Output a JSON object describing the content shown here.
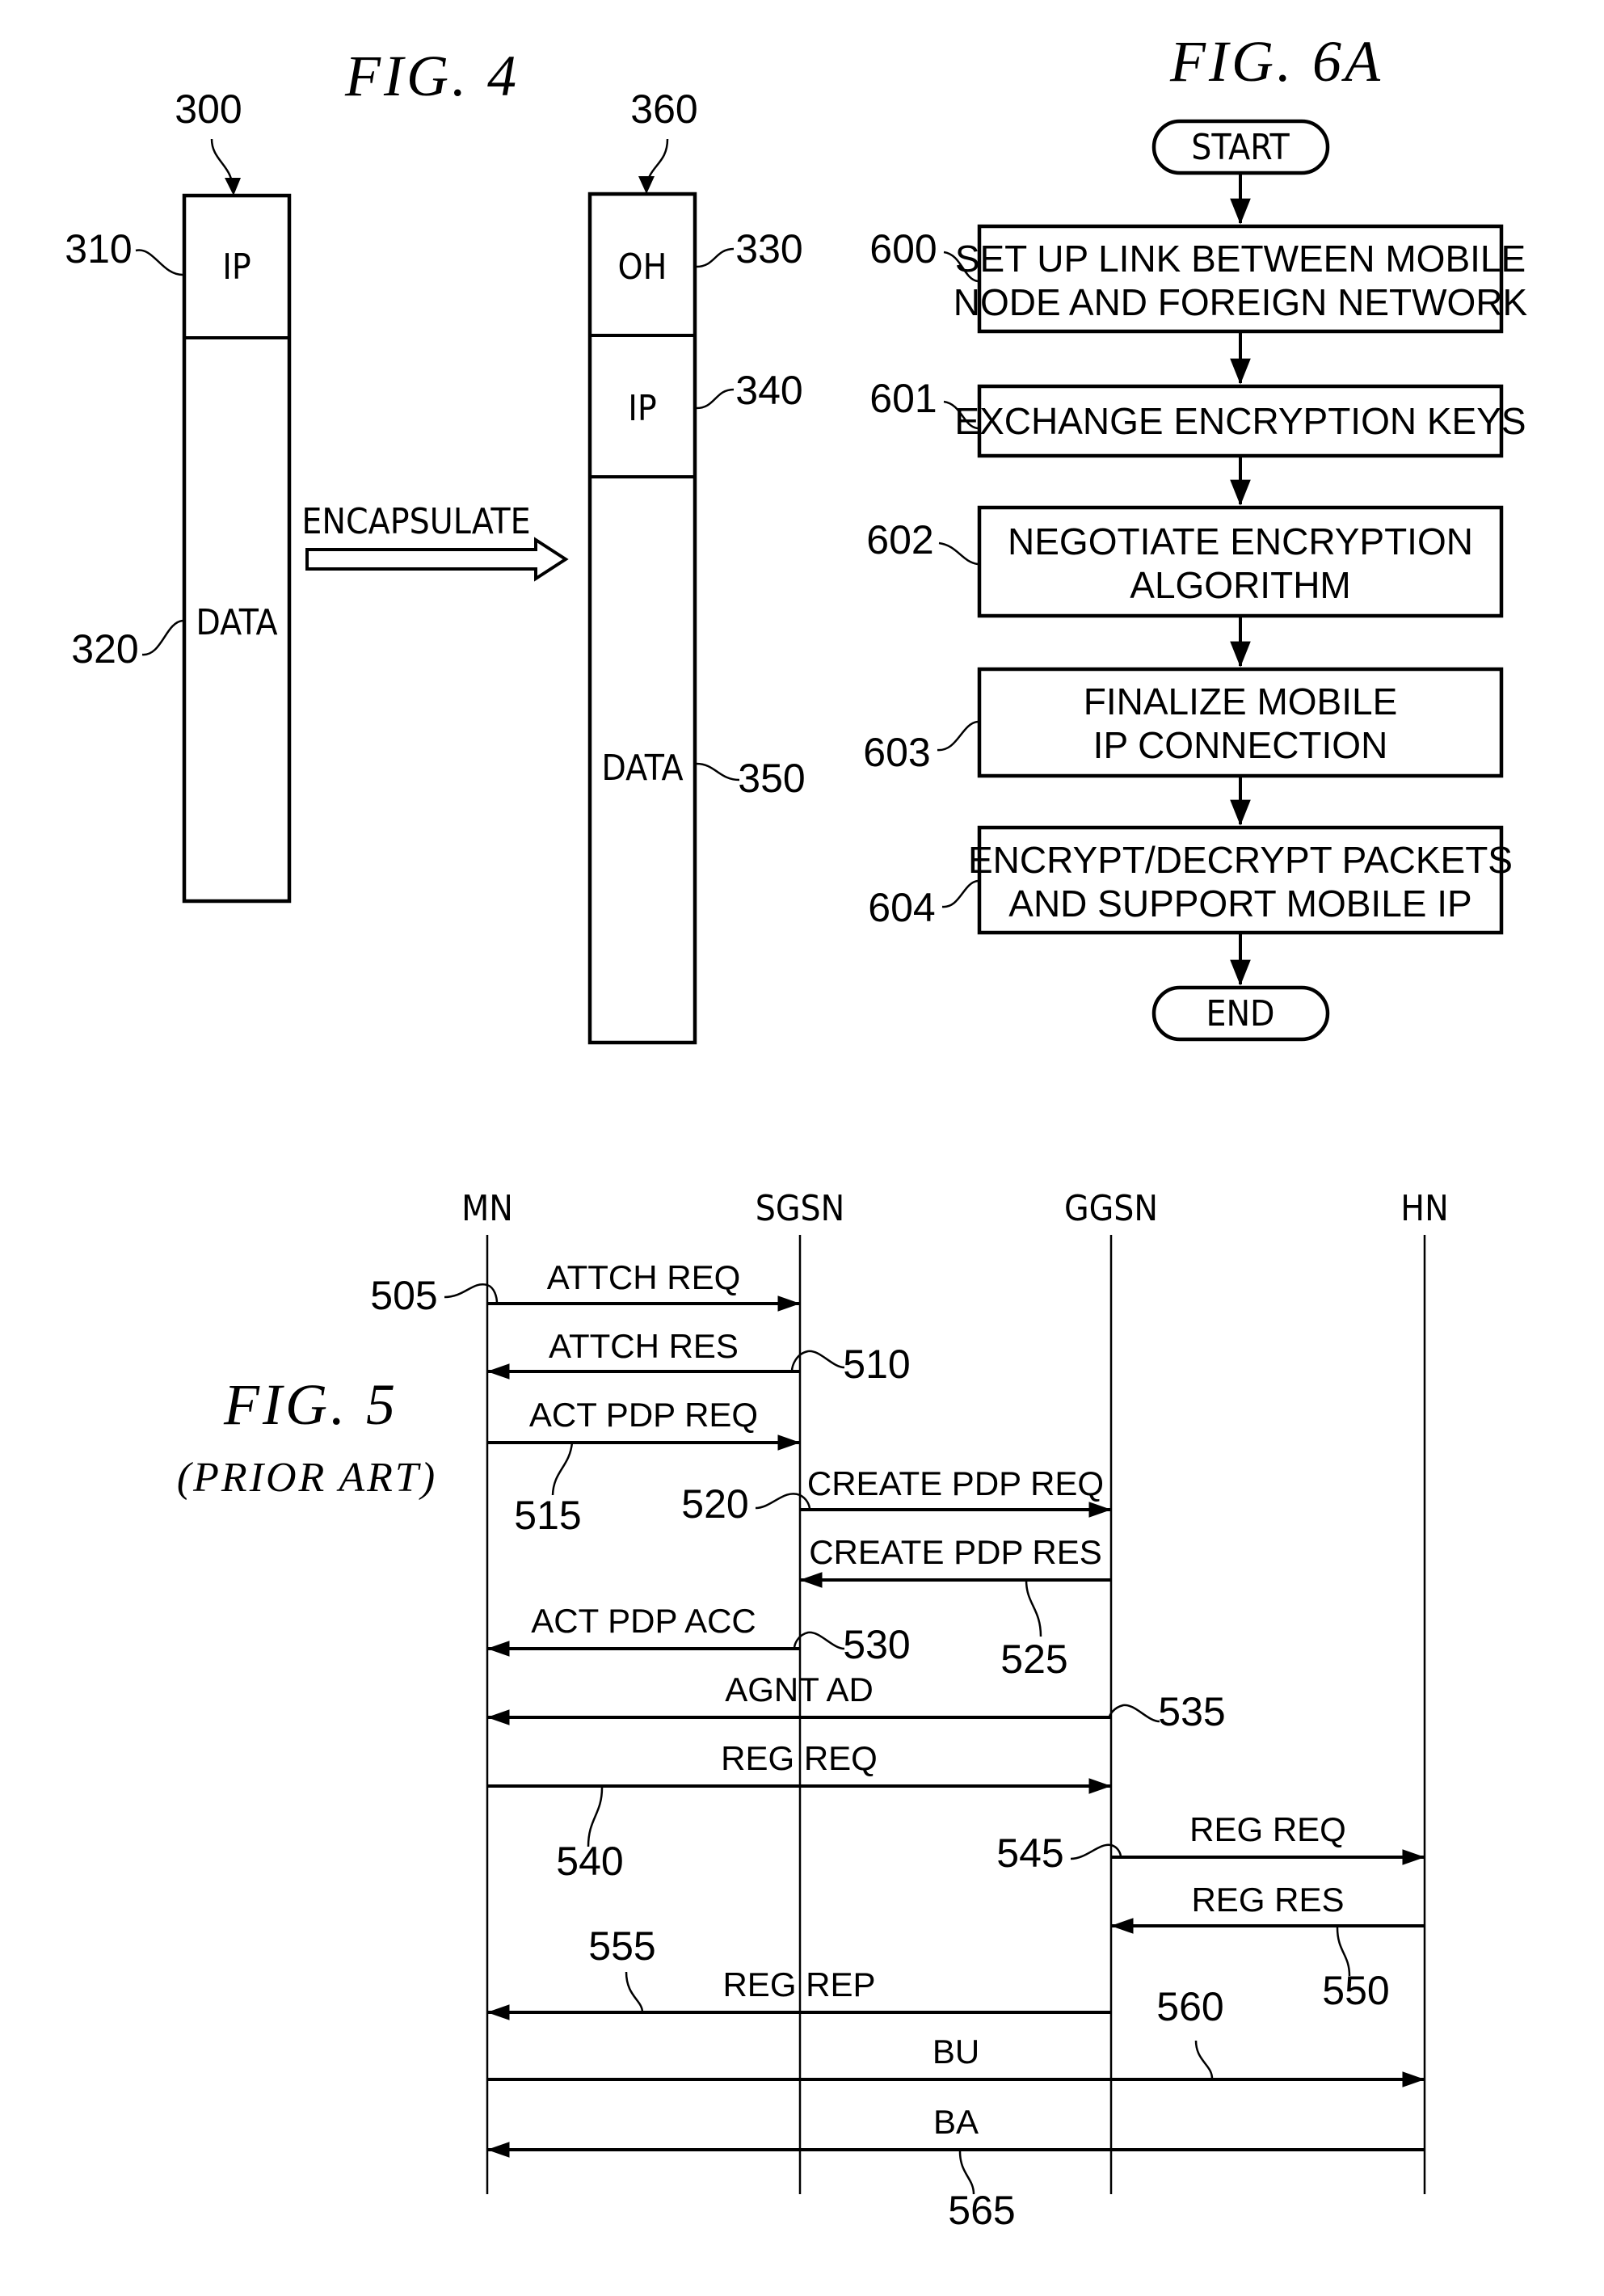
{
  "fig4": {
    "title": "FIG.  4",
    "original_packet": {
      "ref": "300",
      "header": {
        "label": "IP",
        "ref": "310"
      },
      "payload": {
        "label": "DATA",
        "ref": "320"
      }
    },
    "encapsulate_label": "ENCAPSULATE",
    "encapsulated_packet": {
      "ref": "360",
      "outer_header": {
        "label": "OH",
        "ref": "330"
      },
      "inner_header": {
        "label": "IP",
        "ref": "340"
      },
      "payload": {
        "label": "DATA",
        "ref": "350"
      }
    }
  },
  "fig6a": {
    "title": "FIG.  6A",
    "start": "START",
    "end": "END",
    "steps": [
      {
        "ref": "600",
        "lines": [
          "SET UP LINK BETWEEN MOBILE",
          "NODE AND FOREIGN NETWORK"
        ]
      },
      {
        "ref": "601",
        "lines": [
          "EXCHANGE ENCRYPTION KEYS"
        ]
      },
      {
        "ref": "602",
        "lines": [
          "NEGOTIATE ENCRYPTION",
          "ALGORITHM"
        ]
      },
      {
        "ref": "603",
        "lines": [
          "FINALIZE MOBILE",
          "IP CONNECTION"
        ]
      },
      {
        "ref": "604",
        "lines": [
          "ENCRYPT/DECRYPT PACKETS",
          "AND SUPPORT MOBILE IP"
        ]
      }
    ]
  },
  "fig5": {
    "title": "FIG.  5",
    "subtitle": "(PRIOR ART)",
    "entities": [
      "MN",
      "SGSN",
      "GGSN",
      "HN"
    ],
    "messages": [
      {
        "label": "ATTCH REQ",
        "from": "MN",
        "to": "SGSN",
        "ref": "505"
      },
      {
        "label": "ATTCH RES",
        "from": "SGSN",
        "to": "MN",
        "ref": "510"
      },
      {
        "label": "ACT PDP REQ",
        "from": "MN",
        "to": "SGSN",
        "ref": "515"
      },
      {
        "label": "CREATE PDP REQ",
        "from": "SGSN",
        "to": "GGSN",
        "ref": "520"
      },
      {
        "label": "CREATE PDP RES",
        "from": "GGSN",
        "to": "SGSN",
        "ref": "525"
      },
      {
        "label": "ACT PDP ACC",
        "from": "SGSN",
        "to": "MN",
        "ref": "530"
      },
      {
        "label": "AGNT AD",
        "from": "GGSN",
        "to": "MN",
        "ref": "535"
      },
      {
        "label": "REG REQ",
        "from": "MN",
        "to": "GGSN",
        "ref": "540"
      },
      {
        "label": "REG REQ",
        "from": "GGSN",
        "to": "HN",
        "ref": "545"
      },
      {
        "label": "REG RES",
        "from": "HN",
        "to": "GGSN",
        "ref": "550"
      },
      {
        "label": "REG REP",
        "from": "GGSN",
        "to": "MN",
        "ref": "555"
      },
      {
        "label": "BU",
        "from": "MN",
        "to": "HN",
        "ref": "560"
      },
      {
        "label": "BA",
        "from": "HN",
        "to": "MN",
        "ref": "565"
      }
    ]
  }
}
